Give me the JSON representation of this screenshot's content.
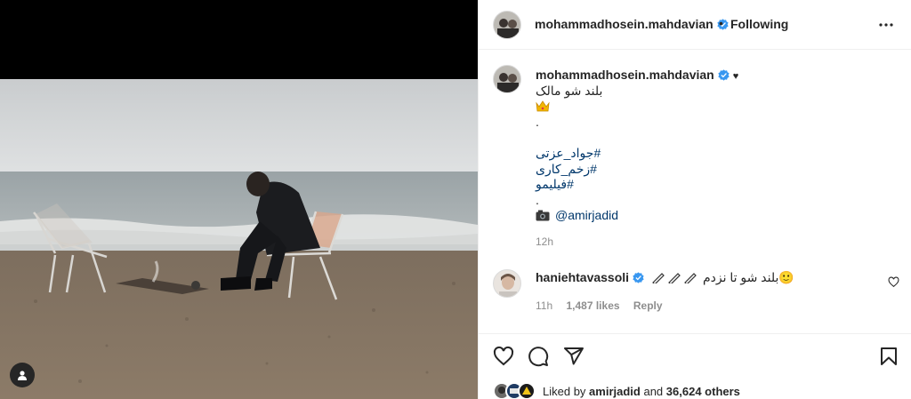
{
  "post": {
    "username": "mohammadhosein.mahdavian",
    "separator": "•",
    "follow_status": "Following"
  },
  "caption": {
    "username": "mohammadhosein.mahdavian",
    "heart": "♥",
    "lines": {
      "l1": "بلند شو مالک",
      "l3": ".",
      "l5": "#جواد_عزتی",
      "l6": "#زخم_کاری",
      "l7": "#فیلیمو",
      "l8": "."
    },
    "credit_mention": "@amirjadid",
    "time": "12h"
  },
  "comment": {
    "username": "haniehtavassoli",
    "text": "🙂بلند شو تا نزدم",
    "time": "11h",
    "likes": "1,487 likes",
    "reply": "Reply"
  },
  "likes": {
    "prefix": "Liked by",
    "user": "amirjadid",
    "middle": "and",
    "others": "36,624 others"
  },
  "icons": {
    "verified": "verified-badge-icon",
    "more": "more-options-icon",
    "heart": "heart-icon",
    "comment": "comment-icon",
    "share": "share-icon",
    "save": "bookmark-icon",
    "tag": "user-tag-icon"
  },
  "colors": {
    "verified_blue": "#3897f0",
    "link_blue": "#00376b",
    "secondary_text": "#8e8e8e",
    "border": "#efefef"
  }
}
